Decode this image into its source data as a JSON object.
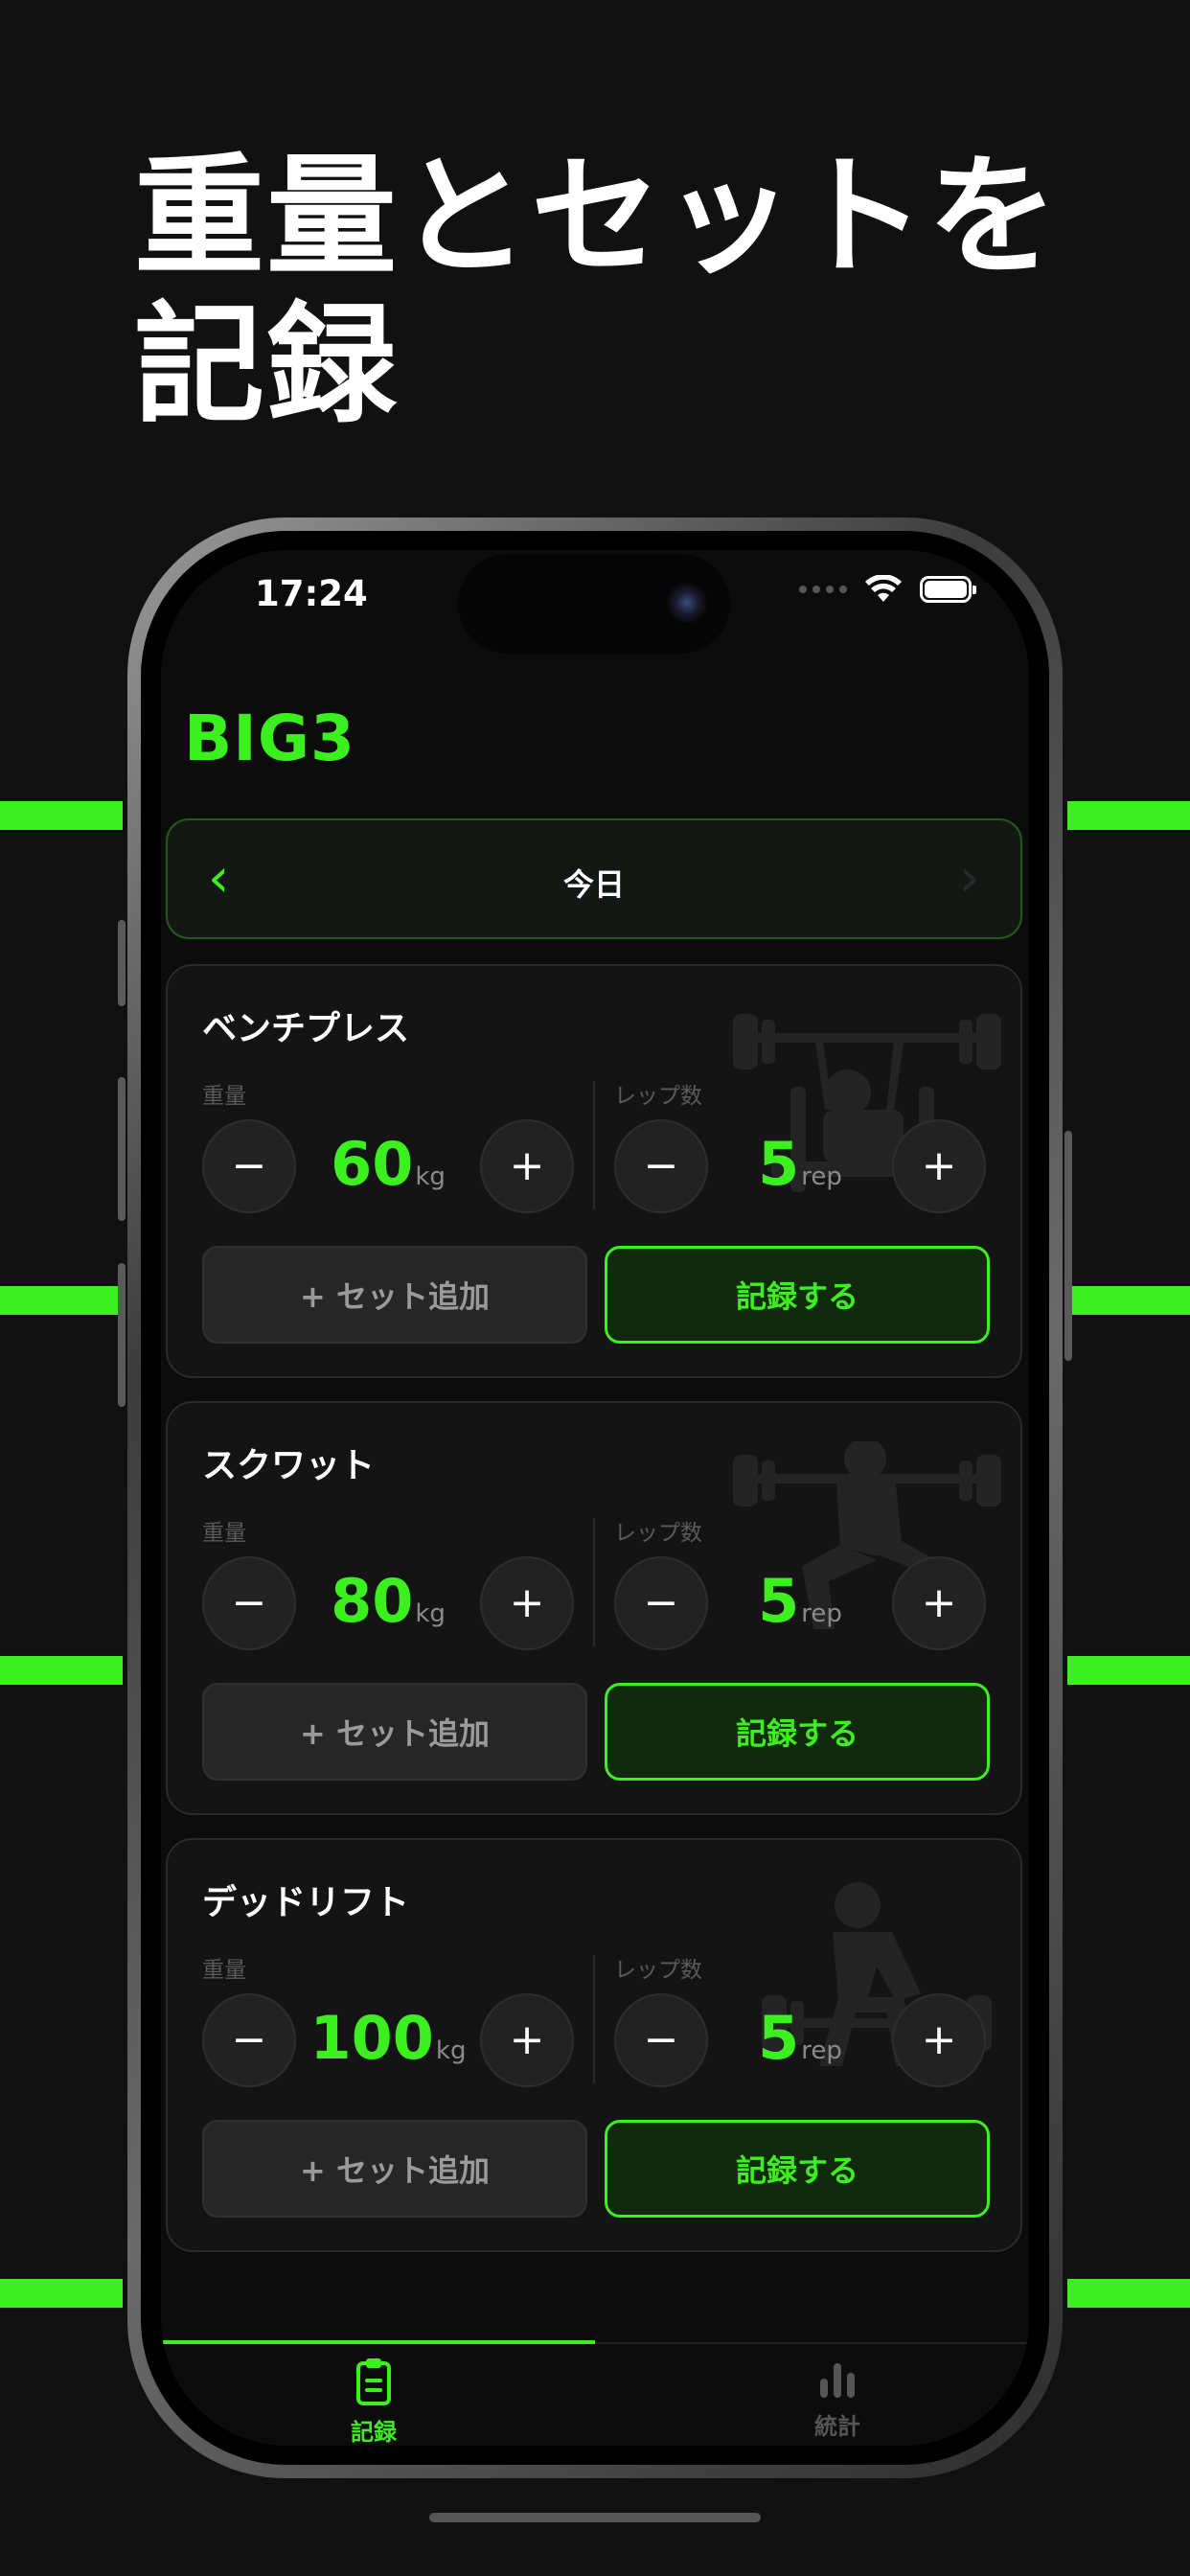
{
  "headline": {
    "line1": "重量とセットを",
    "line2": "記録"
  },
  "status": {
    "time": "17:24"
  },
  "app": {
    "title": "BIG3"
  },
  "date_nav": {
    "prev": "‹",
    "label": "今日",
    "next": "›"
  },
  "labels": {
    "weight": "重量",
    "reps": "レップ数",
    "kg": "kg",
    "rep": "rep",
    "minus": "−",
    "plus": "+",
    "add_set": "+ セット追加",
    "record": "記録する"
  },
  "exercises": [
    {
      "name": "ベンチプレス",
      "weight": "60",
      "reps": "5",
      "icon": "bench-press-icon"
    },
    {
      "name": "スクワット",
      "weight": "80",
      "reps": "5",
      "icon": "squat-icon"
    },
    {
      "name": "デッドリフト",
      "weight": "100",
      "reps": "5",
      "icon": "deadlift-icon"
    }
  ],
  "tabs": [
    {
      "label": "記録",
      "icon": "clipboard-icon",
      "active": true
    },
    {
      "label": "統計",
      "icon": "bar-chart-icon",
      "active": false
    }
  ],
  "colors": {
    "accent": "#3cf01f",
    "background": "#111111",
    "card": "#141414",
    "muted": "#5a5a5a"
  }
}
